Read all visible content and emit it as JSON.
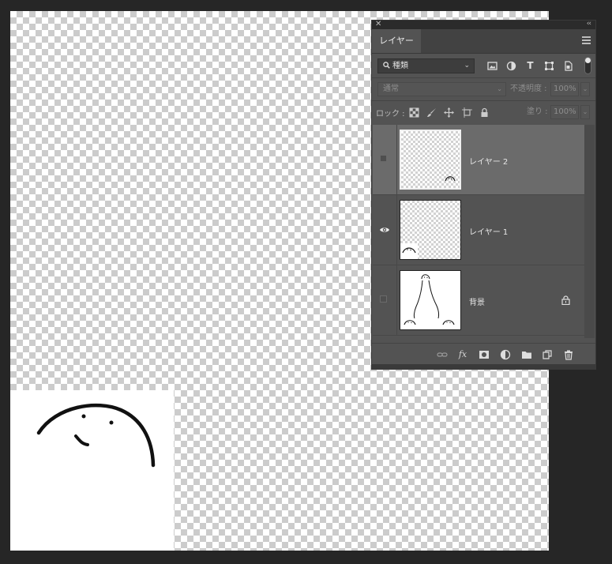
{
  "layers_panel": {
    "tab_label": "レイヤー",
    "filter": {
      "selected": "種類"
    },
    "blend_mode": "通常",
    "opacity_label": "不透明度 :",
    "opacity_value": "100%",
    "lock_label": "ロック :",
    "fill_label": "塗り :",
    "fill_value": "100%",
    "layers": [
      {
        "name": "レイヤー 2",
        "visible": false,
        "selected": true
      },
      {
        "name": "レイヤー 1",
        "visible": true,
        "selected": false
      },
      {
        "name": "背景",
        "visible": false,
        "selected": false,
        "locked": true
      }
    ]
  },
  "colors": {
    "app_background": "#262626",
    "panel_background": "#535353",
    "selected_layer": "#6b6b6b"
  }
}
